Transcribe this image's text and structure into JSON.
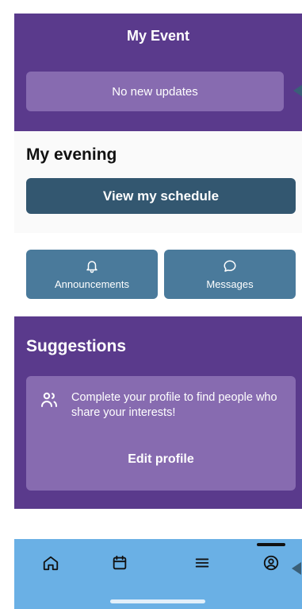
{
  "header": {
    "title": "My Event",
    "updates_text": "No new updates"
  },
  "evening": {
    "title": "My evening",
    "schedule_button": "View my schedule"
  },
  "actions": [
    {
      "label": "Announcements",
      "icon": "bell-icon"
    },
    {
      "label": "Messages",
      "icon": "chat-bubble-icon"
    }
  ],
  "suggestions": {
    "title": "Suggestions",
    "card_icon": "people-icon",
    "card_text": "Complete your profile to find people who share your interests!",
    "edit_button": "Edit profile"
  },
  "nav": {
    "items": [
      {
        "icon": "home-icon"
      },
      {
        "icon": "calendar-icon"
      },
      {
        "icon": "menu-icon"
      },
      {
        "icon": "profile-icon",
        "active": true
      }
    ]
  },
  "colors": {
    "purple": "#5a3a8c",
    "card_purple": "#876bb0",
    "dark_blue": "#335770",
    "action_blue": "#4a7a9b",
    "nav_blue": "#6ab0e5"
  }
}
